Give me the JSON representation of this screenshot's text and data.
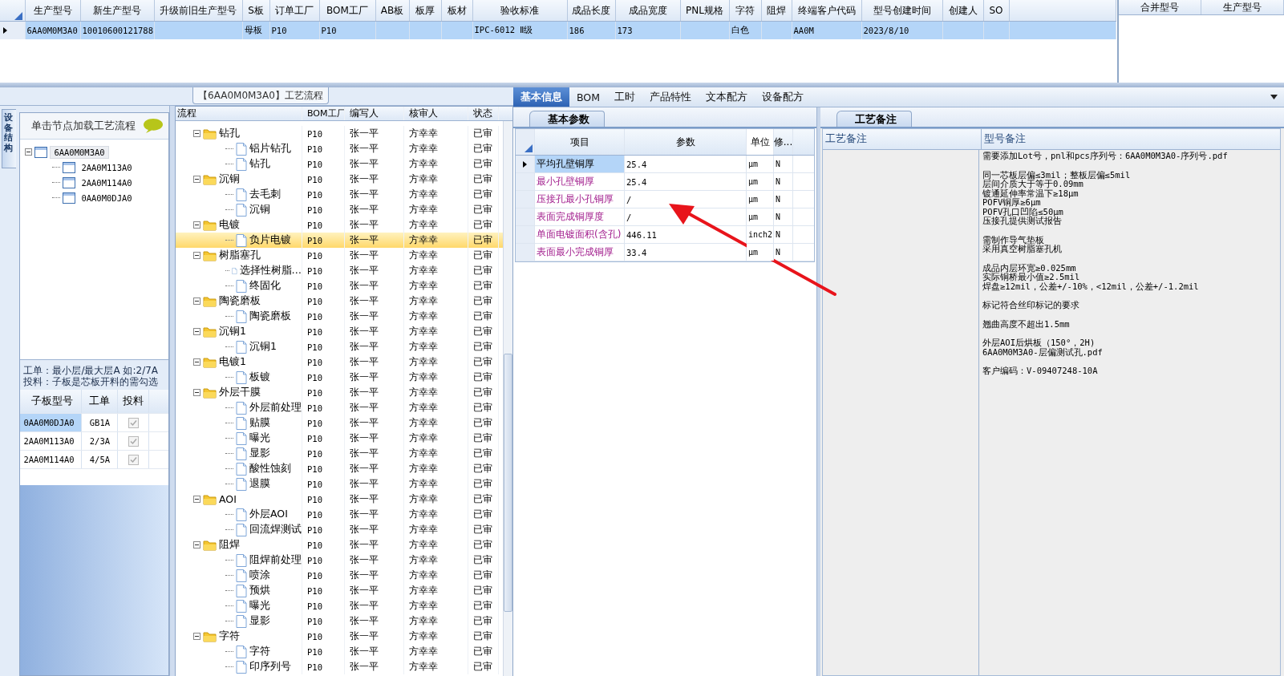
{
  "model_grid": {
    "columns": [
      "生产型号",
      "新生产型号",
      "升级前旧生产型号",
      "S板",
      "订单工厂",
      "BOM工厂",
      "AB板",
      "板厚",
      "板材",
      "验收标准",
      "成品长度",
      "成品宽度",
      "PNL规格",
      "字符",
      "阻焊",
      "终端客户代码",
      "型号创建时间",
      "创建人",
      "SO"
    ],
    "rows": [
      {
        "selected": true,
        "cells": [
          {
            "text": "6AA0M0M3A0"
          },
          {
            "text": "10010600121788"
          },
          {},
          {
            "text": "母板"
          },
          {
            "text": "P10"
          },
          {
            "text": "P10"
          },
          {},
          {},
          {},
          {
            "text": "IPC-6012 Ⅱ级"
          },
          {
            "text": "186"
          },
          {
            "text": "173"
          },
          {},
          {
            "text": "白色"
          },
          {},
          {
            "text": "AA0M"
          },
          {
            "text": "2023/8/10"
          },
          {},
          {}
        ]
      }
    ]
  },
  "merge_grid": {
    "columns": [
      "合并型号",
      "生产型号"
    ]
  },
  "side_tab": "设备结构",
  "structure_panel": {
    "hint": "单击节点加载工艺流程",
    "tree": [
      {
        "label": "6AA0M0M3A0",
        "selected": true,
        "expanded": true,
        "children": [
          {
            "label": "2AA0M113A0",
            "selected": false
          },
          {
            "label": "2AA0M114A0",
            "selected": false
          },
          {
            "label": "0AA0M0DJA0",
            "selected": false
          }
        ]
      }
    ],
    "notes": [
      "工单：最小层/最大层A 如:2/7A",
      "投料：子板是芯板开料的需勾选"
    ],
    "sub_boards": {
      "columns": [
        "子板型号",
        "工单",
        "投料"
      ],
      "rows": [
        {
          "board": "0AA0M0DJA0",
          "order": "GB1A",
          "feed": true,
          "selected": true
        },
        {
          "board": "2AA0M113A0",
          "order": "2/3A",
          "feed": true,
          "selected": false
        },
        {
          "board": "2AA0M114A0",
          "order": "4/5A",
          "feed": true,
          "selected": false
        }
      ]
    }
  },
  "process": {
    "title": "【6AA0M0M3A0】工艺流程",
    "columns": [
      "流程",
      "BOM工厂",
      "编写人",
      "核审人",
      "状态"
    ],
    "nodes": [
      {
        "name": "钻孔",
        "bom": "P10",
        "writer": "张一平",
        "reviewer": "方幸幸",
        "status": "已审",
        "expanded": true,
        "selected": false,
        "children": [
          {
            "name": "铝片钻孔",
            "bom": "P10",
            "writer": "张一平",
            "reviewer": "方幸幸",
            "status": "已审",
            "selected": false
          },
          {
            "name": "钻孔",
            "bom": "P10",
            "writer": "张一平",
            "reviewer": "方幸幸",
            "status": "已审",
            "selected": false
          }
        ]
      },
      {
        "name": "沉铜",
        "bom": "P10",
        "writer": "张一平",
        "reviewer": "方幸幸",
        "status": "已审",
        "expanded": true,
        "selected": false,
        "children": [
          {
            "name": "去毛刺",
            "bom": "P10",
            "writer": "张一平",
            "reviewer": "方幸幸",
            "status": "已审",
            "selected": false
          },
          {
            "name": "沉铜",
            "bom": "P10",
            "writer": "张一平",
            "reviewer": "方幸幸",
            "status": "已审",
            "selected": false
          }
        ]
      },
      {
        "name": "电镀",
        "bom": "P10",
        "writer": "张一平",
        "reviewer": "方幸幸",
        "status": "已审",
        "expanded": true,
        "selected": false,
        "children": [
          {
            "name": "负片电镀",
            "bom": "P10",
            "writer": "张一平",
            "reviewer": "方幸幸",
            "status": "已审",
            "selected": true
          }
        ]
      },
      {
        "name": "树脂塞孔",
        "bom": "P10",
        "writer": "张一平",
        "reviewer": "方幸幸",
        "status": "已审",
        "expanded": true,
        "selected": false,
        "children": [
          {
            "name": "选择性树脂…",
            "bom": "P10",
            "writer": "张一平",
            "reviewer": "方幸幸",
            "status": "已审",
            "selected": false
          },
          {
            "name": "终固化",
            "bom": "P10",
            "writer": "张一平",
            "reviewer": "方幸幸",
            "status": "已审",
            "selected": false
          }
        ]
      },
      {
        "name": "陶瓷磨板",
        "bom": "P10",
        "writer": "张一平",
        "reviewer": "方幸幸",
        "status": "已审",
        "expanded": true,
        "selected": false,
        "children": [
          {
            "name": "陶瓷磨板",
            "bom": "P10",
            "writer": "张一平",
            "reviewer": "方幸幸",
            "status": "已审",
            "selected": false
          }
        ]
      },
      {
        "name": "沉铜1",
        "bom": "P10",
        "writer": "张一平",
        "reviewer": "方幸幸",
        "status": "已审",
        "expanded": true,
        "selected": false,
        "children": [
          {
            "name": "沉铜1",
            "bom": "P10",
            "writer": "张一平",
            "reviewer": "方幸幸",
            "status": "已审",
            "selected": false
          }
        ]
      },
      {
        "name": "电镀1",
        "bom": "P10",
        "writer": "张一平",
        "reviewer": "方幸幸",
        "status": "已审",
        "expanded": true,
        "selected": false,
        "children": [
          {
            "name": "板镀",
            "bom": "P10",
            "writer": "张一平",
            "reviewer": "方幸幸",
            "status": "已审",
            "selected": false
          }
        ]
      },
      {
        "name": "外层干膜",
        "bom": "P10",
        "writer": "张一平",
        "reviewer": "方幸幸",
        "status": "已审",
        "expanded": true,
        "selected": false,
        "children": [
          {
            "name": "外层前处理",
            "bom": "P10",
            "writer": "张一平",
            "reviewer": "方幸幸",
            "status": "已审",
            "selected": false
          },
          {
            "name": "贴膜",
            "bom": "P10",
            "writer": "张一平",
            "reviewer": "方幸幸",
            "status": "已审",
            "selected": false
          },
          {
            "name": "曝光",
            "bom": "P10",
            "writer": "张一平",
            "reviewer": "方幸幸",
            "status": "已审",
            "selected": false
          },
          {
            "name": "显影",
            "bom": "P10",
            "writer": "张一平",
            "reviewer": "方幸幸",
            "status": "已审",
            "selected": false
          },
          {
            "name": "酸性蚀刻",
            "bom": "P10",
            "writer": "张一平",
            "reviewer": "方幸幸",
            "status": "已审",
            "selected": false
          },
          {
            "name": "退膜",
            "bom": "P10",
            "writer": "张一平",
            "reviewer": "方幸幸",
            "status": "已审",
            "selected": false
          }
        ]
      },
      {
        "name": "AOI",
        "bom": "P10",
        "writer": "张一平",
        "reviewer": "方幸幸",
        "status": "已审",
        "expanded": true,
        "selected": false,
        "children": [
          {
            "name": "外层AOI",
            "bom": "P10",
            "writer": "张一平",
            "reviewer": "方幸幸",
            "status": "已审",
            "selected": false
          },
          {
            "name": "回流焊测试",
            "bom": "P10",
            "writer": "张一平",
            "reviewer": "方幸幸",
            "status": "已审",
            "selected": false
          }
        ]
      },
      {
        "name": "阻焊",
        "bom": "P10",
        "writer": "张一平",
        "reviewer": "方幸幸",
        "status": "已审",
        "expanded": true,
        "selected": false,
        "children": [
          {
            "name": "阻焊前处理",
            "bom": "P10",
            "writer": "张一平",
            "reviewer": "方幸幸",
            "status": "已审",
            "selected": false
          },
          {
            "name": "喷涂",
            "bom": "P10",
            "writer": "张一平",
            "reviewer": "方幸幸",
            "status": "已审",
            "selected": false
          },
          {
            "name": "预烘",
            "bom": "P10",
            "writer": "张一平",
            "reviewer": "方幸幸",
            "status": "已审",
            "selected": false
          },
          {
            "name": "曝光",
            "bom": "P10",
            "writer": "张一平",
            "reviewer": "方幸幸",
            "status": "已审",
            "selected": false
          },
          {
            "name": "显影",
            "bom": "P10",
            "writer": "张一平",
            "reviewer": "方幸幸",
            "status": "已审",
            "selected": false
          }
        ]
      },
      {
        "name": "字符",
        "bom": "P10",
        "writer": "张一平",
        "reviewer": "方幸幸",
        "status": "已审",
        "expanded": true,
        "selected": false,
        "children": [
          {
            "name": "字符",
            "bom": "P10",
            "writer": "张一平",
            "reviewer": "方幸幸",
            "status": "已审",
            "selected": false
          },
          {
            "name": "印序列号",
            "bom": "P10",
            "writer": "张一平",
            "reviewer": "方幸幸",
            "status": "已审",
            "selected": false
          }
        ]
      }
    ]
  },
  "detail_tabs": [
    {
      "label": "基本信息",
      "selected": true
    },
    {
      "label": "BOM",
      "selected": false
    },
    {
      "label": "工时",
      "selected": false
    },
    {
      "label": "产品特性",
      "selected": false
    },
    {
      "label": "文本配方",
      "selected": false
    },
    {
      "label": "设备配方",
      "selected": false
    }
  ],
  "basic_params": {
    "tab": "基本参数",
    "columns": [
      "项目",
      "参数",
      "单位",
      "修..."
    ],
    "rows": [
      {
        "item": "平均孔壁铜厚",
        "value": "25.4",
        "unit": "μm",
        "flag": "N",
        "selected": true
      },
      {
        "item": "最小孔壁铜厚",
        "value": "25.4",
        "unit": "μm",
        "flag": "N",
        "selected": false
      },
      {
        "item": "压接孔最小孔铜厚",
        "value": "/",
        "unit": "μm",
        "flag": "N",
        "selected": false
      },
      {
        "item": "表面完成铜厚度",
        "value": "/",
        "unit": "μm",
        "flag": "N",
        "selected": false
      },
      {
        "item": "单面电镀面积(含孔)",
        "value": "446.11",
        "unit": "inch2",
        "flag": "N",
        "selected": false
      },
      {
        "item": "表面最小完成铜厚",
        "value": "33.4",
        "unit": "μm",
        "flag": "N",
        "selected": false
      }
    ]
  },
  "remarks": {
    "tab": "工艺备注",
    "columns": [
      "工艺备注",
      "型号备注"
    ],
    "model_notes": [
      [
        "需要添加Lot号，pnl和pcs序列号：6AA0M0M3A0-序列号.pdf"
      ],
      [
        "同一芯板层偏≤3mil；整板层偏≤5mil",
        "层间介质大于等于0.09mm",
        "镀通延伸率常温下≥18μm",
        "POFV铜厚≥6μm",
        "POFV孔口凹陷≤50μm",
        "压接孔提供测试报告"
      ],
      [
        "需制作导气垫板",
        "采用真空树脂塞孔机"
      ],
      [
        "成品内层环宽≥0.025mm",
        "实际铜桥最小值≥2.5mil",
        "焊盘≥12mil，公差+/-10%，<12mil，公差+/-1.2mil"
      ],
      [
        "标记符合丝印标记的要求"
      ],
      [
        "翘曲高度不超出1.5mm"
      ],
      [
        "外层AOI后烘板（150°，2H)",
        "6AA0M0M3A0-层偏测试孔.pdf"
      ],
      [
        "客户编码：V-09407248-10A"
      ]
    ]
  }
}
